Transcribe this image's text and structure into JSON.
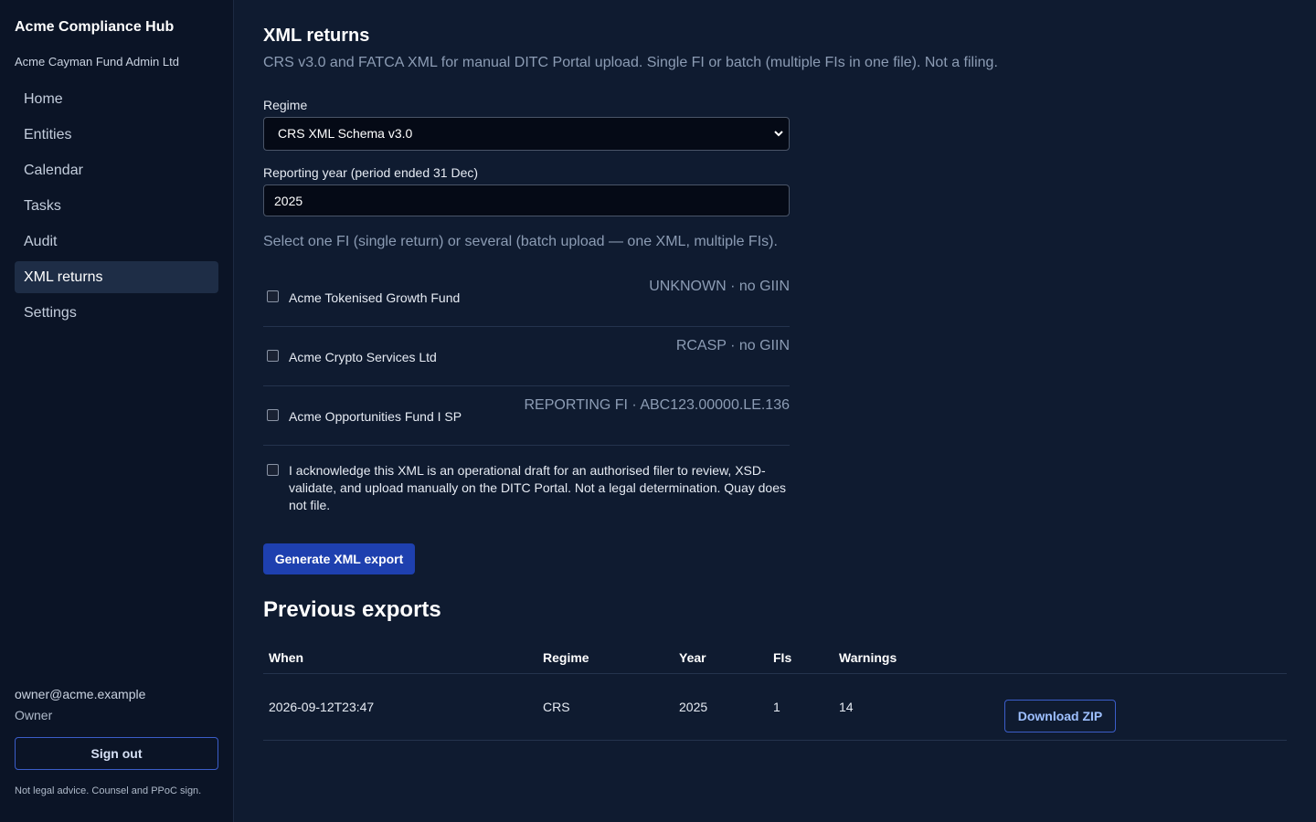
{
  "sidebar": {
    "title": "Acme Compliance Hub",
    "org": "Acme Cayman Fund Admin Ltd",
    "nav": [
      {
        "label": "Home"
      },
      {
        "label": "Entities"
      },
      {
        "label": "Calendar"
      },
      {
        "label": "Tasks"
      },
      {
        "label": "Audit"
      },
      {
        "label": "XML returns"
      },
      {
        "label": "Settings"
      }
    ],
    "active": "XML returns",
    "user_email": "owner@acme.example",
    "user_role": "Owner",
    "signout_label": "Sign out",
    "disclaimer": "Not legal advice. Counsel and PPoC sign."
  },
  "main": {
    "title": "XML returns",
    "subtitle": "CRS v3.0 and FATCA XML for manual DITC Portal upload. Single FI or batch (multiple FIs in one file). Not a filing.",
    "regime_label": "Regime",
    "regime_value": "CRS XML Schema v3.0",
    "year_label": "Reporting year (period ended 31 Dec)",
    "year_value": "2025",
    "select_help": "Select one FI (single return) or several (batch upload — one XML, multiple FIs).",
    "fis": [
      {
        "name": "Acme Tokenised Growth Fund",
        "meta": "UNKNOWN · no GIIN",
        "checked": false
      },
      {
        "name": "Acme Crypto Services Ltd",
        "meta": "RCASP · no GIIN",
        "checked": false
      },
      {
        "name": "Acme Opportunities Fund I SP",
        "meta": "REPORTING FI · ABC123.00000.LE.136",
        "checked": false
      }
    ],
    "acknowledgement": "I acknowledge this XML is an operational draft for an authorised filer to review, XSD-validate, and upload manually on the DITC Portal. Not a legal determination. Quay does not file.",
    "acknowledged": false,
    "generate_label": "Generate XML export",
    "previous_title": "Previous exports",
    "table": {
      "headers": [
        "When",
        "Regime",
        "Year",
        "FIs",
        "Warnings"
      ],
      "rows": [
        {
          "when": "2026-09-12T23:47",
          "regime": "CRS",
          "year": "2025",
          "fis": "1",
          "warnings": "14",
          "action": "Download ZIP"
        }
      ]
    }
  }
}
